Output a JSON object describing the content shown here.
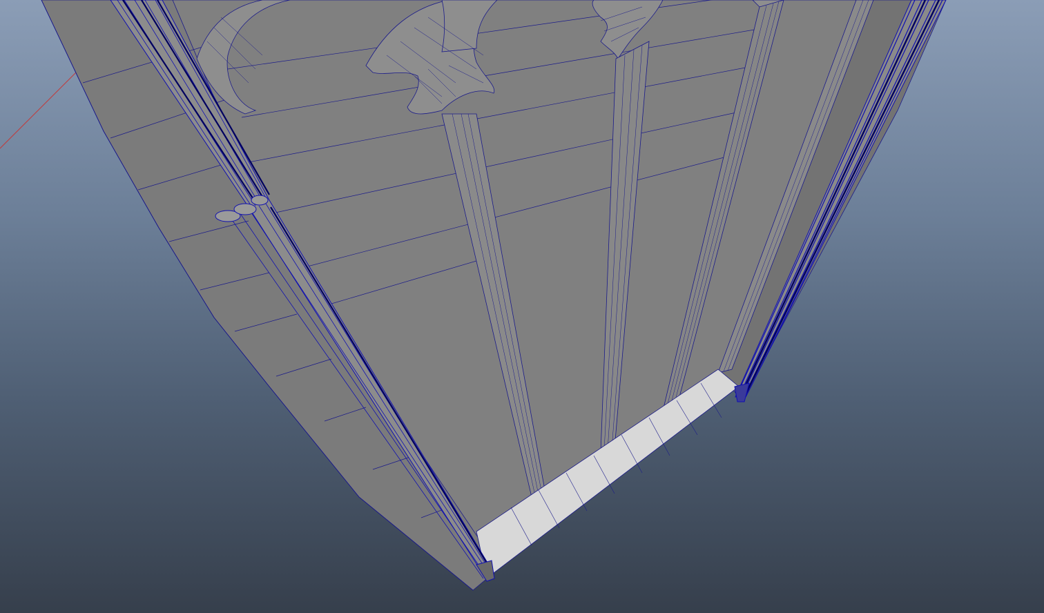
{
  "viewport": {
    "background_top": "#8b9db6",
    "background_bottom": "#363f4c",
    "wireframe_color": "#1a1a8a",
    "selected_color": "#1010b0",
    "axis_color": "#c23a3a",
    "mesh_face_color": "#7a7a7a",
    "mesh_light_color": "#d8d8d8"
  }
}
